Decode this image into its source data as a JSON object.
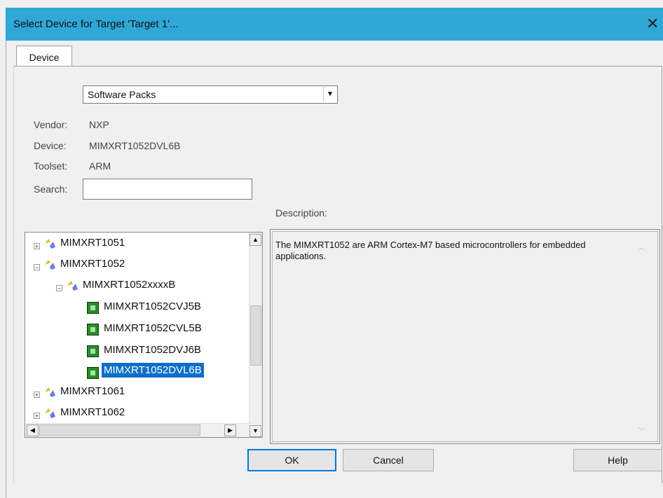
{
  "window": {
    "title": "Select Device for Target 'Target 1'...",
    "close_glyph": "✕"
  },
  "tabs": [
    {
      "label": "Device"
    }
  ],
  "packs_select": {
    "value": "Software Packs"
  },
  "info": {
    "vendor_label": "Vendor:",
    "vendor_value": "NXP",
    "device_label": "Device:",
    "device_value": "MIMXRT1052DVL6B",
    "toolset_label": "Toolset:",
    "toolset_value": "ARM",
    "search_label": "Search:",
    "search_value": ""
  },
  "tree": {
    "nodes": [
      {
        "label": "MIMXRT1051",
        "kind": "family",
        "expander": "+",
        "icon": "package-icon"
      },
      {
        "label": "MIMXRT1052",
        "kind": "family",
        "expander": "−",
        "icon": "package-icon"
      },
      {
        "label": "MIMXRT1052xxxxB",
        "kind": "subfamily",
        "expander": "−",
        "icon": "package-icon"
      },
      {
        "label": "MIMXRT1052CVJ5B",
        "kind": "device",
        "icon": "chip-icon"
      },
      {
        "label": "MIMXRT1052CVL5B",
        "kind": "device",
        "icon": "chip-icon"
      },
      {
        "label": "MIMXRT1052DVJ6B",
        "kind": "device",
        "icon": "chip-icon"
      },
      {
        "label": "MIMXRT1052DVL6B",
        "kind": "device",
        "icon": "chip-icon",
        "selected": true
      },
      {
        "label": "MIMXRT1061",
        "kind": "family",
        "expander": "+",
        "icon": "package-icon"
      },
      {
        "label": "MIMXRT1062",
        "kind": "family",
        "expander": "+",
        "icon": "package-icon"
      }
    ]
  },
  "description": {
    "label": "Description:",
    "text": "The MIMXRT1052 are ARM Cortex-M7 based microcontrollers for embedded applications."
  },
  "buttons": {
    "ok": "OK",
    "cancel": "Cancel",
    "help": "Help"
  },
  "colors": {
    "titlebar": "#2fa8d8",
    "selection": "#0d6fc9",
    "chip": "#2a8a2a"
  }
}
